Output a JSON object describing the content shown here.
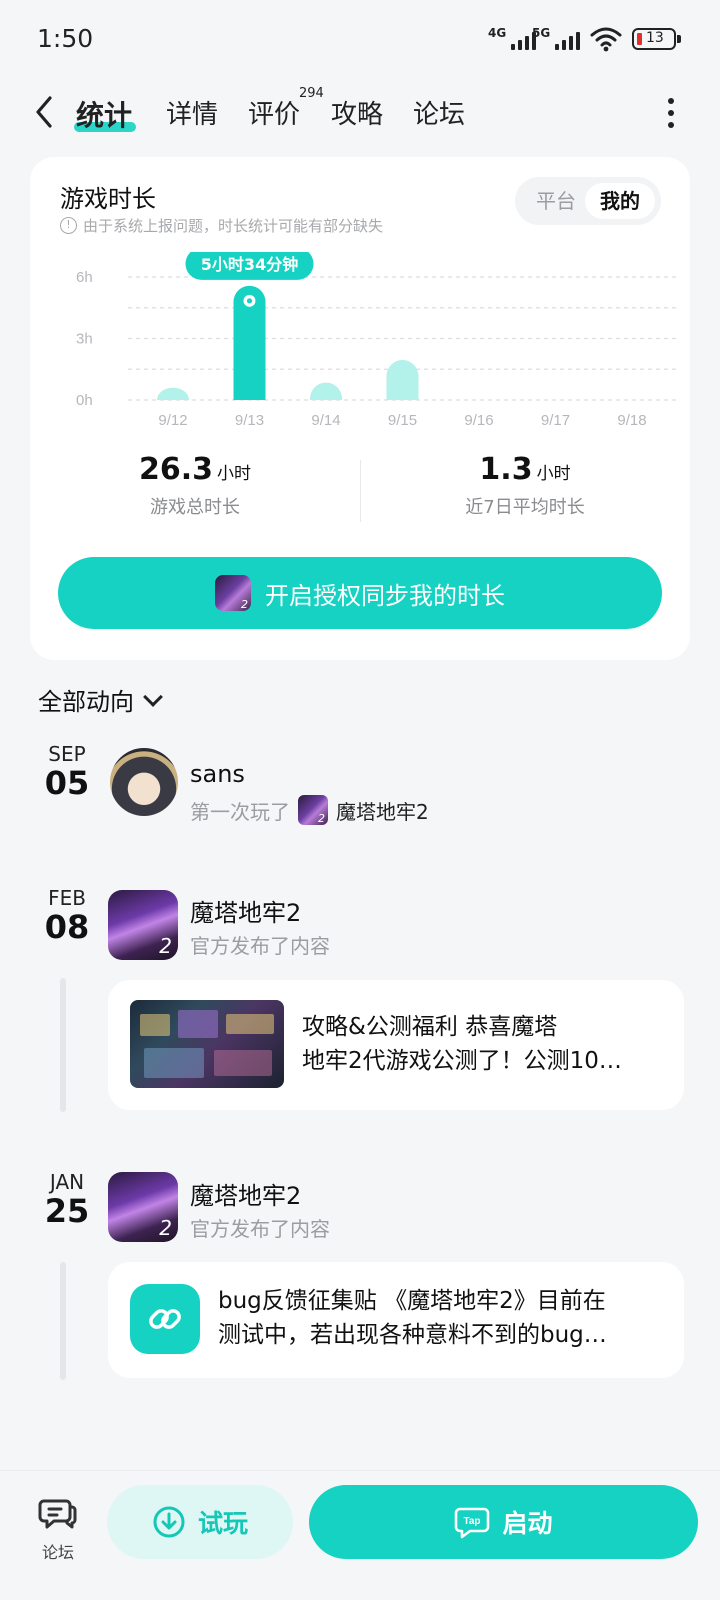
{
  "status_bar": {
    "time": "1:50",
    "net1": "4G",
    "net2": "5G",
    "battery": "13"
  },
  "header": {
    "tabs": [
      {
        "label": "统计",
        "active": true
      },
      {
        "label": "详情",
        "active": false
      },
      {
        "label": "评价",
        "active": false
      },
      {
        "label": "攻略",
        "active": false
      },
      {
        "label": "论坛",
        "active": false
      }
    ],
    "review_count": "294"
  },
  "stats_card": {
    "title": "游戏时长",
    "note": "由于系统上报问题，时长统计可能有部分缺失",
    "toggle": {
      "platform": "平台",
      "mine": "我的"
    },
    "total": {
      "value": "26.3",
      "unit": "小时",
      "label": "游戏总时长"
    },
    "avg": {
      "value": "1.3",
      "unit": "小时",
      "label": "近7日平均时长"
    },
    "sync_button": "开启授权同步我的时长"
  },
  "chart_data": {
    "type": "bar",
    "categories": [
      "9/12",
      "9/13",
      "9/14",
      "9/15",
      "9/16",
      "9/17",
      "9/18"
    ],
    "values": [
      0.6,
      5.57,
      0.85,
      1.95,
      0,
      0,
      0
    ],
    "y_ticks": [
      "0h",
      "3h",
      "6h"
    ],
    "ylim": [
      0,
      6
    ],
    "highlight_index": 1,
    "tooltip": "5小时34分钟",
    "colors": {
      "highlight": "#15d2c2",
      "normal": "#b3f1eb"
    },
    "grid": true
  },
  "feed": {
    "heading": "全部动向",
    "entries": [
      {
        "month": "SEP",
        "day": "05",
        "title": "sans",
        "sub_prefix": "第一次玩了",
        "game": "魔塔地牢2"
      },
      {
        "month": "FEB",
        "day": "08",
        "title": "魔塔地牢2",
        "sub": "官方发布了内容",
        "post_line1": "攻略&公测福利 恭喜魔塔",
        "post_line2": "地牢2代游戏公测了！公测10…"
      },
      {
        "month": "JAN",
        "day": "25",
        "title": "魔塔地牢2",
        "sub": "官方发布了内容",
        "post_line1": "bug反馈征集贴 《魔塔地牢2》目前在",
        "post_line2": "测试中，若出现各种意料不到的bug…"
      }
    ]
  },
  "bottom_bar": {
    "forum_label": "论坛",
    "try_label": "试玩",
    "launch_label": "启动",
    "tap_logo": "Tap"
  }
}
